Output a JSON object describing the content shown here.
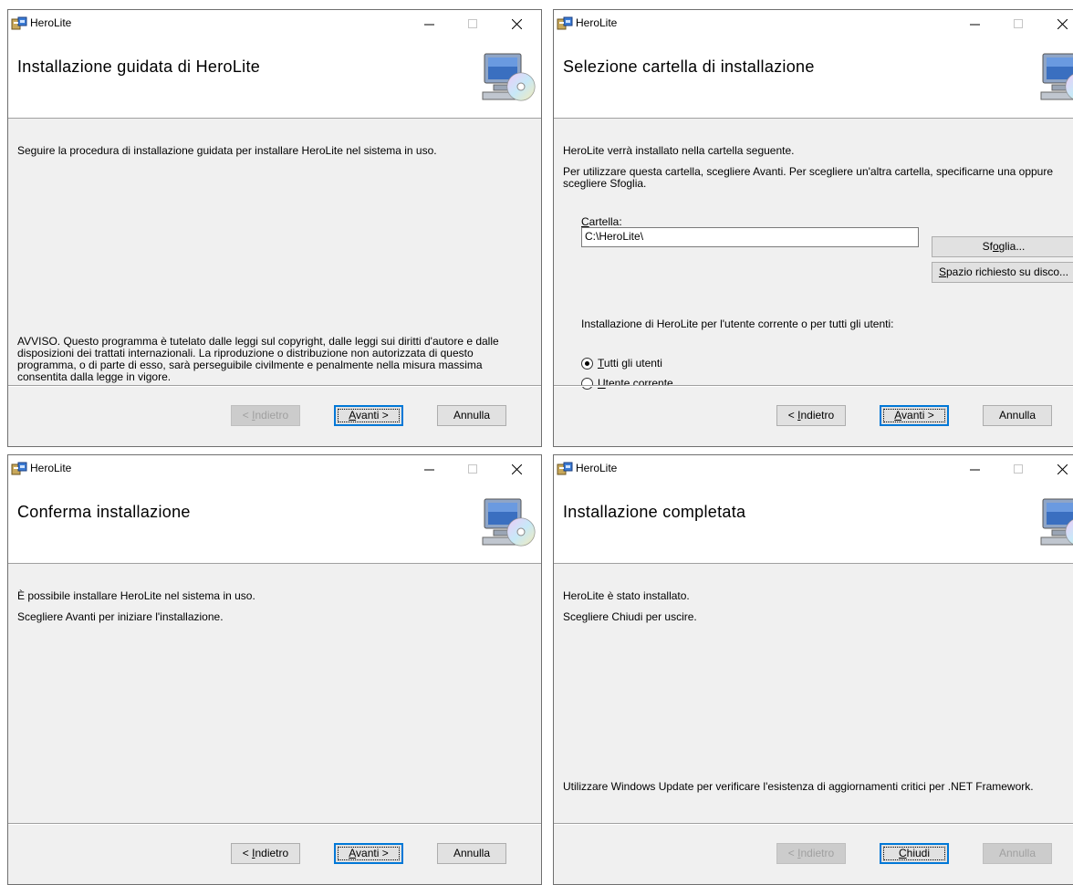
{
  "app_name": "HeroLite",
  "windows": [
    {
      "banner_title": "Installazione guidata di HeroLite",
      "intro": "Seguire la procedura di installazione guidata per installare HeroLite nel sistema in uso.",
      "warning": "AVVISO. Questo programma è tutelato dalle leggi sul copyright, dalle leggi sui diritti d'autore e dalle disposizioni dei trattati internazionali. La riproduzione o distribuzione non autorizzata di questo programma, o di parte di esso, sarà perseguibile civilmente e penalmente nella misura massima consentita dalla legge in vigore.",
      "back_label_pre": "< ",
      "back_label_key": "I",
      "back_label_post": "ndietro",
      "next_label_key": "A",
      "next_label_post": "vanti >",
      "cancel_label": "Annulla",
      "back_enabled": false
    },
    {
      "banner_title": "Selezione cartella di installazione",
      "line1": "HeroLite verrà installato nella cartella seguente.",
      "line2": "Per utilizzare questa cartella, scegliere Avanti. Per scegliere un'altra cartella, specificarne una oppure scegliere Sfoglia.",
      "folder_label_key": "C",
      "folder_label_post": "artella:",
      "folder_value": "C:\\HeroLite\\",
      "browse_pre": "Sf",
      "browse_key": "o",
      "browse_post": "glia...",
      "disk_key": "S",
      "disk_post": "pazio richiesto su disco...",
      "scope_question": "Installazione di HeroLite per l'utente corrente o per tutti gli utenti:",
      "radio_all_key": "T",
      "radio_all_post": "utti gli utenti",
      "radio_current_key": "U",
      "radio_current_post": "tente corrente",
      "selected": "all",
      "back_label_pre": "< ",
      "back_label_key": "I",
      "back_label_post": "ndietro",
      "next_label_key": "A",
      "next_label_post": "vanti >",
      "cancel_label": "Annulla"
    },
    {
      "banner_title": "Conferma installazione",
      "line1": "È possibile installare HeroLite nel sistema in uso.",
      "line2": "Scegliere Avanti per iniziare l'installazione.",
      "back_label_pre": "< ",
      "back_label_key": "I",
      "back_label_post": "ndietro",
      "next_label_key": "A",
      "next_label_post": "vanti >",
      "cancel_label": "Annulla"
    },
    {
      "banner_title": "Installazione completata",
      "line1": "HeroLite è stato installato.",
      "line2": "Scegliere Chiudi per uscire.",
      "footer_note": "Utilizzare Windows Update per verificare l'esistenza di aggiornamenti critici per .NET Framework.",
      "back_label_pre": "< ",
      "back_label_key": "I",
      "back_label_post": "ndietro",
      "close_key": "C",
      "close_post": "hiudi",
      "cancel_label": "Annulla"
    }
  ],
  "colors": {
    "accent": "#0078d7",
    "window_bg": "#f0f0f0",
    "disabled_text": "#a0a0a0"
  },
  "icons": {
    "app": "installer-app-icon",
    "banner": "computer-cd-icon"
  }
}
